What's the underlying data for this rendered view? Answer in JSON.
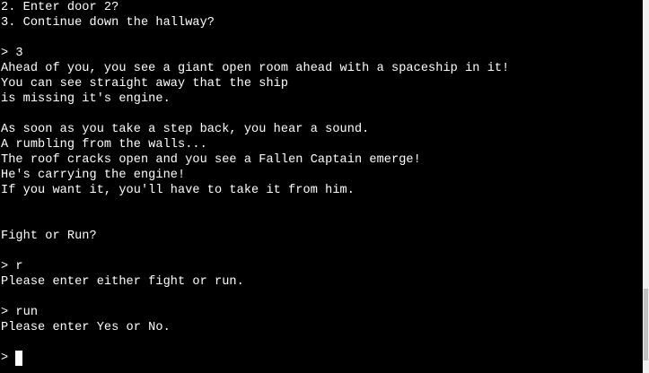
{
  "terminal": {
    "lines": [
      "2. Enter door 2?",
      "3. Continue down the hallway?",
      "",
      "> 3",
      "Ahead of you, you see a giant open room ahead with a spaceship in it!",
      "You can see straight away that the ship",
      "is missing it's engine.",
      "",
      "As soon as you take a step back, you hear a sound.",
      "A rumbling from the walls...",
      "The roof cracks open and you see a Fallen Captain emerge!",
      "He's carrying the engine!",
      "If you want it, you'll have to take it from him.",
      "",
      "",
      "Fight or Run?",
      "",
      "> r",
      "Please enter either fight or run.",
      "",
      "> run",
      "Please enter Yes or No."
    ],
    "prompt_symbol": ">"
  }
}
